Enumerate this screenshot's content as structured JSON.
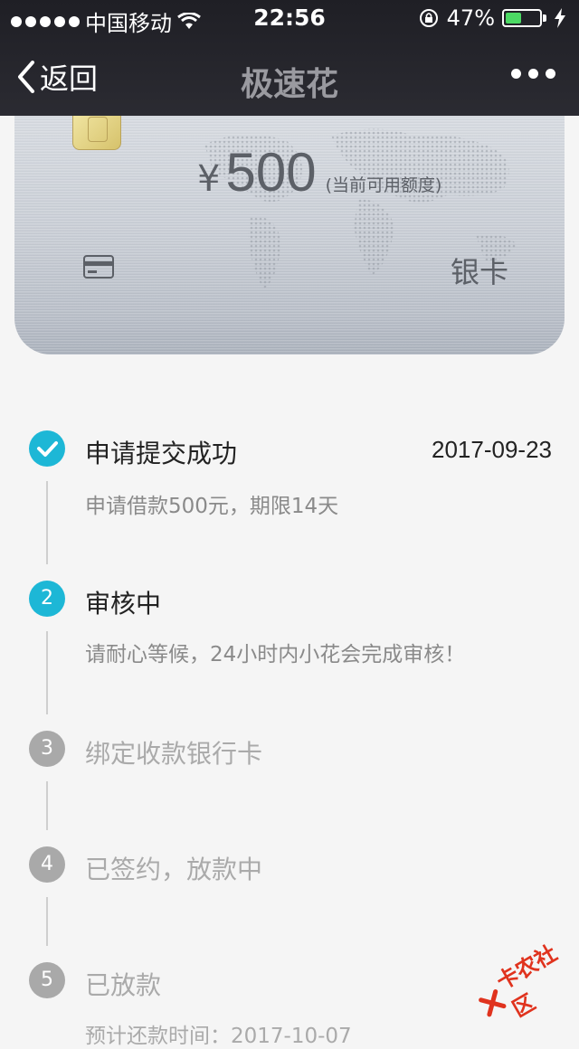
{
  "status": {
    "carrier": "中国移动",
    "time": "22:56",
    "battery_percent": "47%",
    "battery_level": 0.47,
    "icons": [
      "signal-dots",
      "wifi-icon",
      "orientation-lock-icon",
      "battery-icon",
      "charging-bolt-icon"
    ]
  },
  "nav": {
    "back_label": "返回",
    "title": "极速花",
    "more_icon": "more-dots-icon"
  },
  "card": {
    "currency_symbol": "¥",
    "amount": "500",
    "amount_label": "(当前可用额度)",
    "card_type": "银卡",
    "colors": {
      "card_bg": "#c7ccd4",
      "text": "#5c6067"
    }
  },
  "steps": [
    {
      "badge": "✓",
      "state": "done",
      "title": "申请提交成功",
      "date": "2017-09-23",
      "desc": "申请借款500元，期限14天"
    },
    {
      "badge": "2",
      "state": "active",
      "title": "审核中",
      "date": "",
      "desc": "请耐心等候，24小时内小花会完成审核！"
    },
    {
      "badge": "3",
      "state": "pending",
      "title": "绑定收款银行卡",
      "date": "",
      "desc": ""
    },
    {
      "badge": "4",
      "state": "pending",
      "title": "已签约，放款中",
      "date": "",
      "desc": ""
    },
    {
      "badge": "5",
      "state": "pending",
      "title": "已放款",
      "date": "",
      "desc": "预计还款时间：2017-10-07"
    }
  ],
  "watermark": {
    "text": "卡农社区"
  },
  "colors": {
    "accent": "#1db7d6",
    "pending": "#a9a9a9",
    "bg": "#f5f5f5"
  }
}
